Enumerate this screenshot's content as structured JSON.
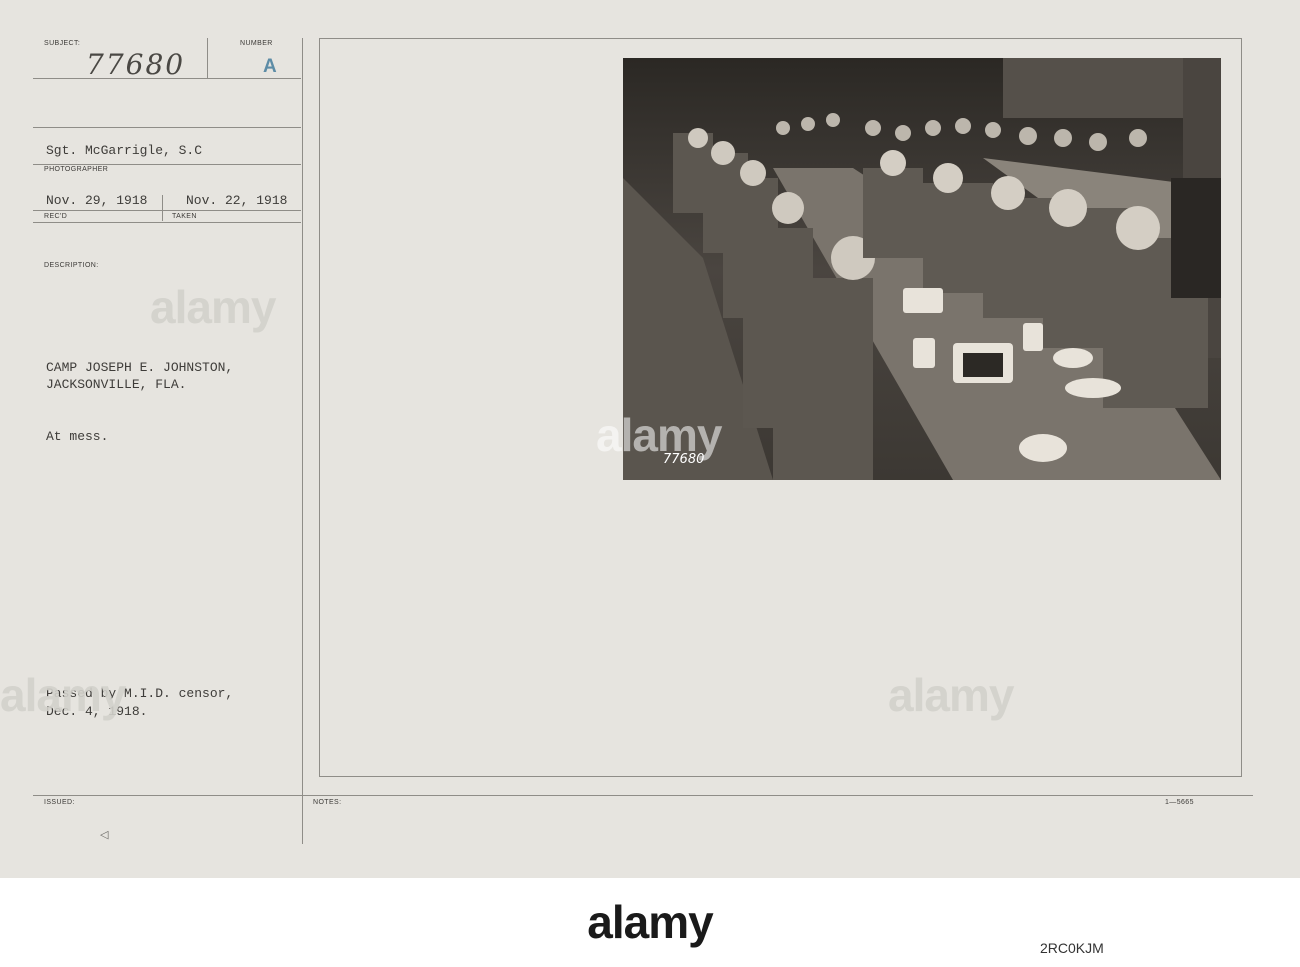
{
  "card": {
    "subject_label": "SUBJECT:",
    "subject_value": "77680",
    "number_label": "NUMBER",
    "number_value": "A",
    "photographer_value": "Sgt. McGarrigle, S.C",
    "photographer_label": "PHOTOGRAPHER",
    "recd_value": "Nov. 29, 1918",
    "recd_label": "REC'D",
    "taken_value": "Nov. 22, 1918",
    "taken_label": "TAKEN",
    "description_label": "DESCRIPTION:",
    "description_line1": "CAMP JOSEPH E. JOHNSTON,",
    "description_line2": "JACKSONVILLE, FLA.",
    "description_line3": "At mess.",
    "censor_line1": "Passed by M.I.D. censor,",
    "censor_line2": "Dec. 4, 1918.",
    "issued_label": "ISSUED:",
    "issued_mark": "◁",
    "notes_label": "NOTES:",
    "form_number": "1—5665",
    "photo_caption": "77680"
  },
  "watermark": {
    "text": "alamy"
  },
  "footer": {
    "logo": "alamy",
    "image_id": "2RC0KJM"
  }
}
